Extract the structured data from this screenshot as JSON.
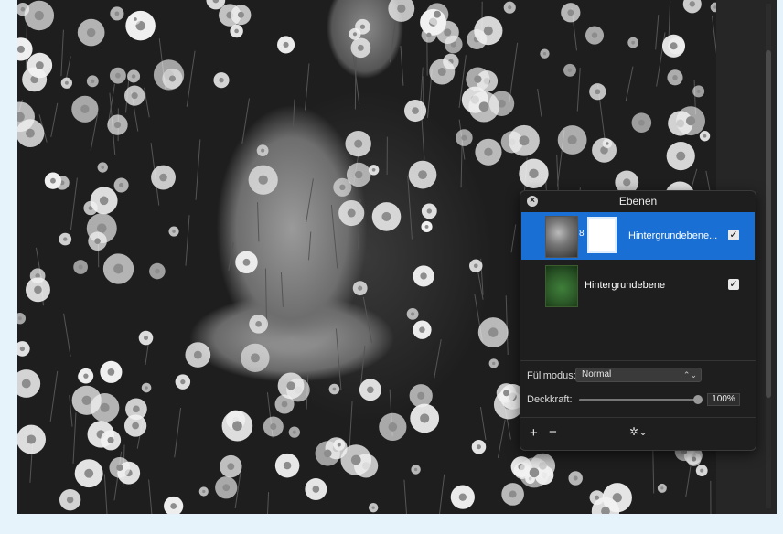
{
  "panel": {
    "title": "Ebenen",
    "close_glyph": "×",
    "layers": [
      {
        "name": "Hintergrundebene...",
        "selected": true,
        "visible_check": "✓"
      },
      {
        "name": "Hintergrundebene",
        "selected": false,
        "visible_check": "✓"
      }
    ],
    "fill_mode_label": "Füllmodus:",
    "fill_mode_value": "Normal",
    "fill_mode_arrows": "⌃⌄",
    "opacity_label": "Deckkraft:",
    "opacity_value": "100%",
    "opacity_fraction": 1.0,
    "add_glyph": "+",
    "remove_glyph": "−",
    "gear_glyph": "✲⌄",
    "link_glyph": "8"
  },
  "colors": {
    "selection": "#1a6fd4",
    "panel_bg": "#1e1e1f"
  }
}
